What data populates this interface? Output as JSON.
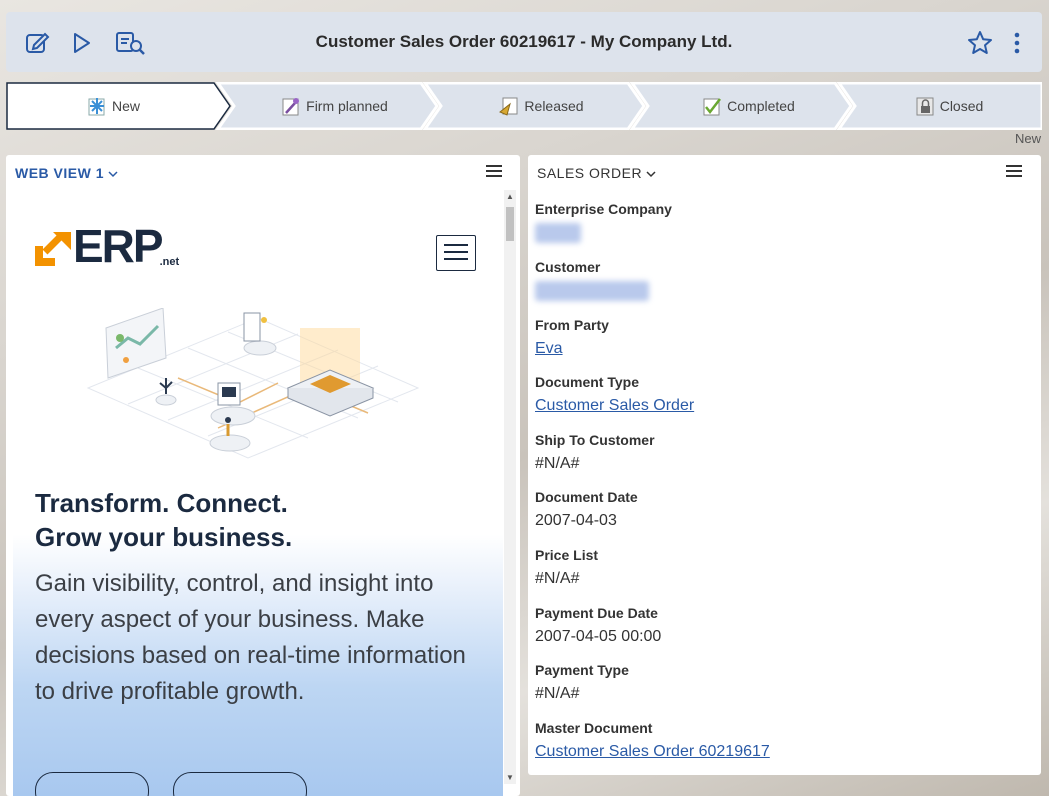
{
  "window": {
    "title": "Customer Sales Order 60219617 - My Company Ltd.",
    "icons": [
      "edit-icon",
      "run-icon",
      "document-search-icon",
      "star-icon",
      "more-vertical-icon"
    ]
  },
  "workflow": {
    "steps": [
      {
        "label": "New",
        "icon": "new-state-icon",
        "active": true
      },
      {
        "label": "Firm planned",
        "icon": "firm-planned-icon",
        "active": false
      },
      {
        "label": "Released",
        "icon": "released-icon",
        "active": false
      },
      {
        "label": "Completed",
        "icon": "completed-icon",
        "active": false
      },
      {
        "label": "Closed",
        "icon": "lock-icon",
        "active": false
      }
    ],
    "current_status": "New"
  },
  "left_panel": {
    "header": "WEB VIEW 1",
    "web": {
      "logo": "ERP",
      "logo_suffix": ".net",
      "headline_1": "Transform. Connect.",
      "headline_2": "Grow your business.",
      "subtext": "Gain visibility, control, and insight into every aspect of your business. Make decisions based on real-time information to drive profitable growth."
    }
  },
  "right_panel": {
    "header": "SALES ORDER",
    "fields": [
      {
        "label": "Enterprise Company",
        "value": "",
        "blurred": true
      },
      {
        "label": "Customer",
        "value": "",
        "blurred": true
      },
      {
        "label": "From Party",
        "value": "Eva",
        "link": true
      },
      {
        "label": "Document Type",
        "value": "Customer Sales Order",
        "link": true
      },
      {
        "label": "Ship To Customer",
        "value": "#N/A#"
      },
      {
        "label": "Document Date",
        "value": "2007-04-03"
      },
      {
        "label": "Price List",
        "value": "#N/A#"
      },
      {
        "label": "Payment Due Date",
        "value": "2007-04-05 00:00"
      },
      {
        "label": "Payment Type",
        "value": "#N/A#"
      },
      {
        "label": "Master Document",
        "value": "Customer Sales Order 60219617",
        "link": true
      }
    ]
  },
  "colors": {
    "accent": "#2a5aa6",
    "logo_orange": "#f39200",
    "logo_navy": "#1b2a40"
  }
}
